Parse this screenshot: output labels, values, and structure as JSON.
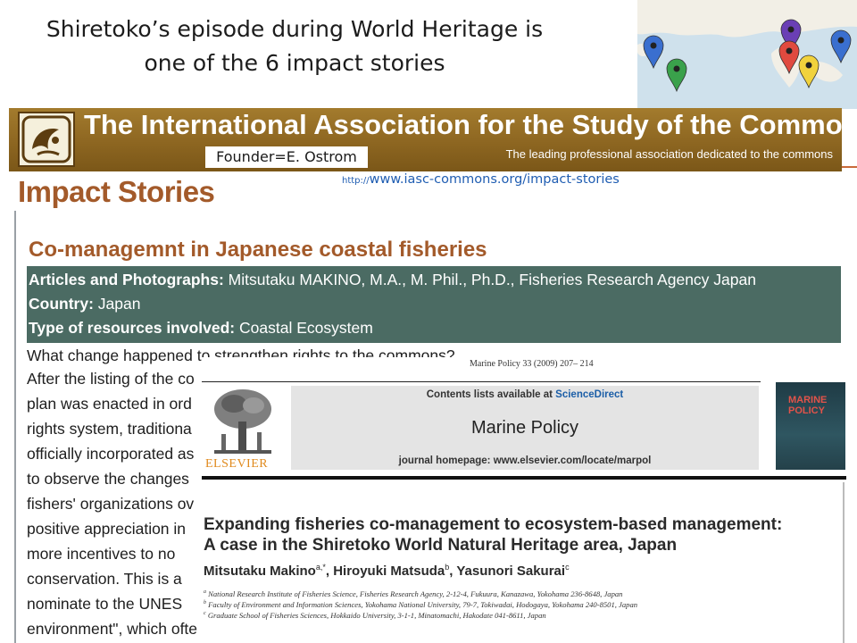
{
  "slide": {
    "title_line1": "Shiretoko’s episode during World Heritage is",
    "title_line2": "one of the 6 impact stories"
  },
  "banner": {
    "title": "The International Association for the Study of the Commons",
    "tagline": "The leading professional association dedicated to the commons",
    "founder": "Founder=E. Ostrom"
  },
  "url": {
    "protocol": "http://",
    "address": "www.iasc-commons.org/impact-stories"
  },
  "webpage": {
    "heading": "Impact Stories",
    "article_title": "Co-managemnt in Japanese coastal fisheries",
    "info": [
      {
        "label": "Articles and Photographs:",
        "value": " Mitsutaku MAKINO, M.A., M. Phil., Ph.D., Fisheries Research Agency Japan"
      },
      {
        "label": "Country:",
        "value": " Japan"
      },
      {
        "label": "Type of resources involved:",
        "value": " Coastal Ecosystem"
      }
    ],
    "body_lines": [
      "What change happened to strengthen rights to the commons?",
      "After the listing of the co",
      "plan was enacted in ord",
      "rights system, traditiona",
      "officially incorporated as",
      "to observe the changes",
      "fishers' organizations ov",
      "positive appreciation in",
      "more  incentives  to  no",
      "conservation.  This  is  a",
      "nominate to the UNES",
      "environment\", which ofte"
    ]
  },
  "paper": {
    "citation": "Marine Policy 33 (2009) 207– 214",
    "contents_prefix": "Contents lists available at ",
    "contents_link": "ScienceDirect",
    "journal": "Marine Policy",
    "homepage": "journal homepage: www.elsevier.com/locate/marpol",
    "publisher": "ELSEVIER",
    "cover_title": "MARINE POLICY",
    "title_line1": "Expanding fisheries co-management to ecosystem-based management:",
    "title_line2": "A case in the Shiretoko World Natural Heritage area, Japan",
    "authors": [
      {
        "name": "Mitsutaku Makino",
        "sup": "a,*"
      },
      {
        "name": "Hiroyuki Matsuda",
        "sup": "b"
      },
      {
        "name": "Yasunori Sakurai",
        "sup": "c"
      }
    ],
    "affiliations": [
      {
        "sup": "a",
        "text": "National Research Institute of Fisheries Science, Fisheries Research Agency, 2-12-4, Fukuura, Kanazawa, Yokohama 236-8648, Japan"
      },
      {
        "sup": "b",
        "text": "Faculty of Environment and Information Sciences, Yokohama National University, 79-7, Tokiwadai, Hodogaya, Yokohama 240-8501, Japan"
      },
      {
        "sup": "c",
        "text": "Graduate School of Fisheries Sciences, Hokkaido University, 3-1-1, Minatomachi, Hakodate 041-8611, Japan"
      }
    ]
  },
  "map": {
    "pins": [
      {
        "color": "#2e9a46"
      },
      {
        "color": "#3a6fcf"
      },
      {
        "color": "#3aa14b"
      },
      {
        "color": "#6a3fb5"
      },
      {
        "color": "#e04a3f"
      },
      {
        "color": "#f1d23c"
      },
      {
        "color": "#3a6fcf"
      }
    ]
  }
}
